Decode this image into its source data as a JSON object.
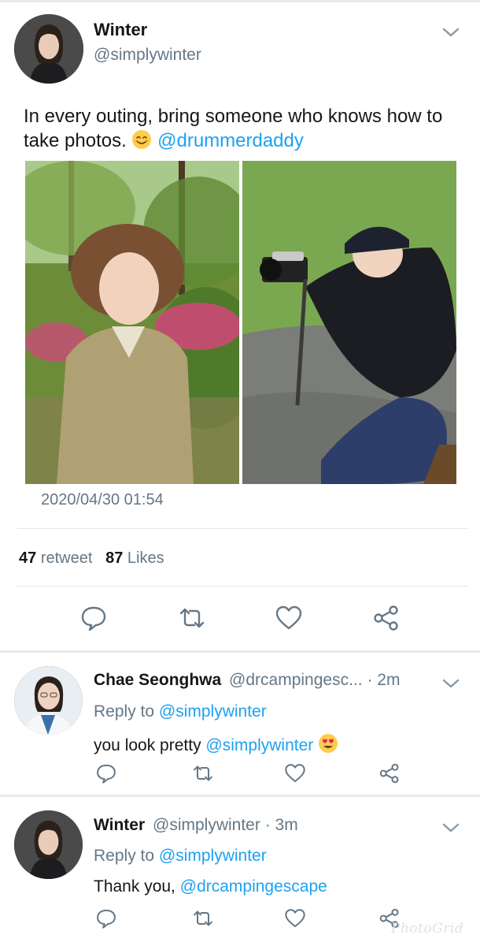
{
  "colors": {
    "link": "#1da1f2",
    "secondary": "#657786",
    "text": "#14171a",
    "divider": "#e1e8ed"
  },
  "main_tweet": {
    "author_name": "Winter",
    "author_handle": "@simplywinter",
    "text": "In every outing, bring someone who knows how to take photos.",
    "emoji": "smiling-face-emoji",
    "mention": "@drummerdaddy",
    "timestamp": "2020/04/30 01:54",
    "retweet_count": "47",
    "retweet_label": "retweet",
    "like_count": "87",
    "like_label": "Likes",
    "actions": [
      "reply-icon",
      "retweet-icon",
      "like-icon",
      "share-icon"
    ]
  },
  "replies": [
    {
      "name": "Chae Seonghwa",
      "handle": "@drcampingesc...",
      "time": "· 2m",
      "reply_to_label": "Reply to",
      "reply_to_handle": "@simplywinter",
      "text": "you look pretty",
      "mention": "@simplywinter",
      "emoji": "heart-eyes-emoji"
    },
    {
      "name": "Winter",
      "handle": "@simplywinter",
      "time": "· 3m",
      "reply_to_label": "Reply to",
      "reply_to_handle": "@simplywinter",
      "text": "Thank you,",
      "mention": "@drcampingescape"
    }
  ],
  "watermark": "PhotoGrid"
}
